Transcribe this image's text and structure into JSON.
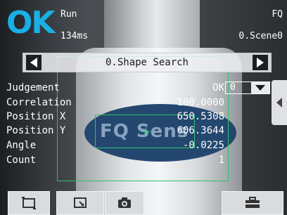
{
  "status": {
    "result": "OK",
    "mode": "Run",
    "time": "134ms"
  },
  "header": {
    "brand": "FQ",
    "scene": "0.Scene0"
  },
  "nav": {
    "title": "0.Shape Search"
  },
  "judgement": {
    "label": "Judgement",
    "value": "OK",
    "selector_value": "0"
  },
  "results": [
    {
      "label": "Correlation",
      "value": "100.0000"
    },
    {
      "label": "Position X",
      "value": "650.5308"
    },
    {
      "label": "Position Y",
      "value": "606.3644"
    },
    {
      "label": "Angle",
      "value": "-0.0225"
    },
    {
      "label": "Count",
      "value": "1"
    }
  ],
  "camera": {
    "label_text": "FQ Sens"
  },
  "icons": {
    "nav_prev": "arrow-left-icon",
    "nav_next": "arrow-right-icon",
    "dropdown": "triangle-down-icon",
    "side_tab": "triangle-left-icon",
    "tool1": "frame-icon",
    "tool2": "zoom-window-icon",
    "tool3": "camera-icon",
    "tool4": "toolbox-icon"
  },
  "colors": {
    "ok": "#1ab0e6",
    "roi": "#29c16a",
    "label_oval": "#24476f"
  }
}
